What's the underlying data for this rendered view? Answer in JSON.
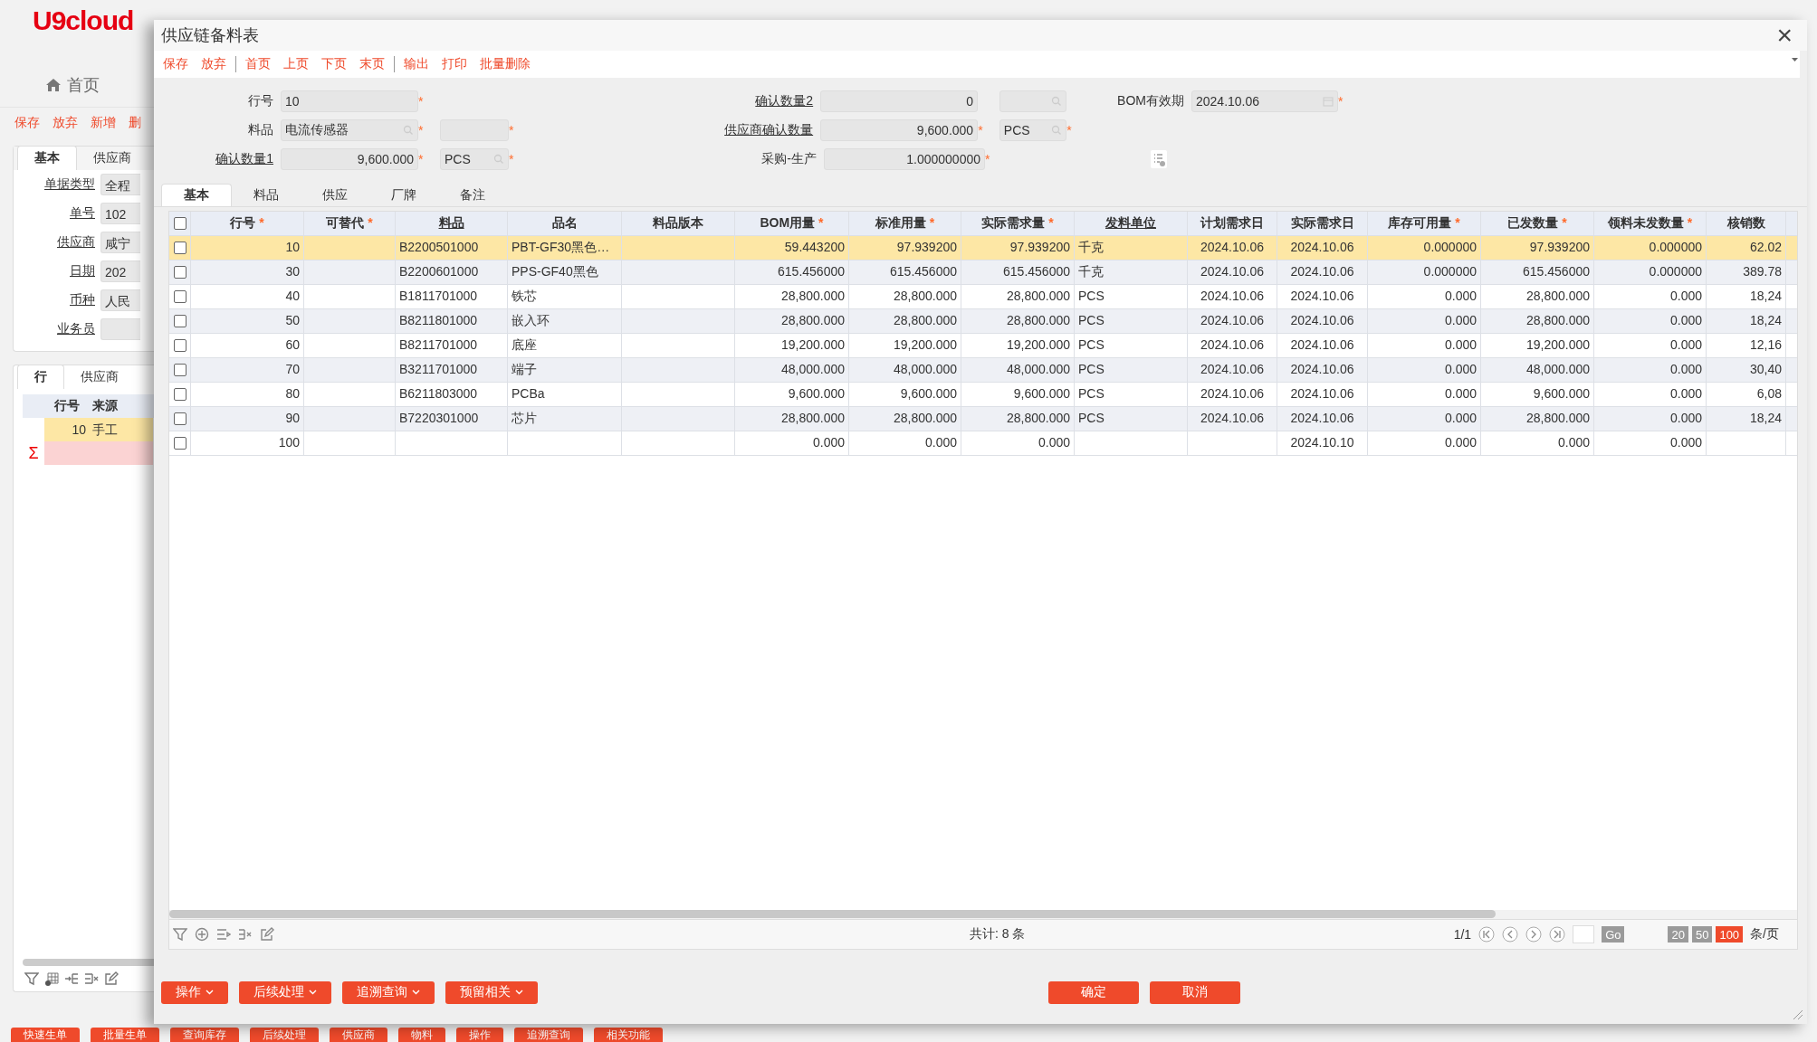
{
  "background": {
    "logo": "U9cloud",
    "home": "首页",
    "toolbar": [
      "保存",
      "放弃",
      "新增",
      "删"
    ],
    "tabs": [
      {
        "label": "基本",
        "selected": true
      },
      {
        "label": "供应商",
        "selected": false
      }
    ],
    "fields": [
      {
        "label": "单据类型",
        "value": "全程"
      },
      {
        "label": "单号",
        "value": "102"
      },
      {
        "label": "供应商",
        "value": "咸宁"
      },
      {
        "label": "日期",
        "value": "202"
      },
      {
        "label": "币种",
        "value": "人民"
      },
      {
        "label": "业务员"
      }
    ],
    "line_tabs": [
      {
        "label": "行",
        "selected": true
      },
      {
        "label": "供应商",
        "selected": false
      }
    ],
    "table": {
      "columns": [
        "行号",
        "来源"
      ],
      "rows": [
        [
          "10",
          "手工"
        ]
      ],
      "sum_mark": "Σ"
    },
    "bottom_buttons": [
      "快速生单",
      "批量生单",
      "查询库存",
      "后续处理",
      "供应商",
      "物料",
      "操作",
      "追溯查询",
      "相关功能"
    ]
  },
  "dialog": {
    "title": "供应链备料表",
    "close": "×",
    "toolbar": [
      [
        "保存",
        "放弃"
      ],
      [
        "首页",
        "上页",
        "下页",
        "末页"
      ],
      [
        "输出",
        "打印",
        "批量删除"
      ]
    ],
    "form": [
      [
        {
          "label": "行号",
          "link": false,
          "value": "10",
          "kind": "text",
          "mark": "*"
        },
        {
          "label": "确认数量2",
          "link": true,
          "value": "0",
          "kind": "number",
          "unit": {
            "lookup": true
          }
        },
        {
          "label": "BOM有效期",
          "link": false,
          "value": "2024.10.06",
          "kind": "date",
          "mark": "*"
        }
      ],
      [
        {
          "label": "料品",
          "link": false,
          "value": "电流传感器",
          "kind": "lookup",
          "mark": "*",
          "unit": {
            "lookup": false,
            "mark": "*"
          }
        },
        {
          "label": "供应商确认数量",
          "link": true,
          "value": "9,600.000",
          "kind": "number",
          "mark": "*",
          "unit": {
            "value": "PCS",
            "lookup": true,
            "mark": "*"
          }
        }
      ],
      [
        {
          "label": "确认数量1",
          "link": true,
          "value": "9,600.000",
          "kind": "number",
          "mark": "*",
          "unit": {
            "value": "PCS",
            "lookup": true,
            "mark": "*"
          }
        },
        {
          "label": "采购-生产",
          "link": false,
          "value": "1.000000000",
          "kind": "number",
          "mark": "*"
        }
      ]
    ],
    "tabs": [
      {
        "label": "基本",
        "selected": true
      },
      {
        "label": "料品",
        "selected": false
      },
      {
        "label": "供应",
        "selected": false
      },
      {
        "label": "厂牌",
        "selected": false
      },
      {
        "label": "备注",
        "selected": false
      }
    ],
    "table": {
      "select_all_checked": false,
      "columns": [
        {
          "label": "行号",
          "mark": "*",
          "link": false
        },
        {
          "label": "可替代",
          "mark": "*",
          "link": false
        },
        {
          "label": "料品",
          "link": true
        },
        {
          "label": "品名",
          "link": false
        },
        {
          "label": "料品版本",
          "link": false
        },
        {
          "label": "BOM用量",
          "mark": "*",
          "link": false
        },
        {
          "label": "标准用量",
          "mark": "*",
          "link": false
        },
        {
          "label": "实际需求量",
          "mark": "*",
          "link": false
        },
        {
          "label": "发料单位",
          "link": true
        },
        {
          "label": "计划需求日",
          "link": false
        },
        {
          "label": "实际需求日",
          "link": false
        },
        {
          "label": "库存可用量",
          "mark": "*",
          "link": false
        },
        {
          "label": "已发数量",
          "mark": "*",
          "link": false
        },
        {
          "label": "领料未发数量",
          "mark": "*",
          "link": false
        },
        {
          "label": "核销数",
          "link": false
        }
      ],
      "rows": [
        {
          "selected": true,
          "checked": false,
          "cells": [
            "10",
            "",
            "B2200501000",
            "PBT-GF30黑色…",
            "",
            "59.443200",
            "97.939200",
            "97.939200",
            "千克",
            "2024.10.06",
            "2024.10.06",
            "0.000000",
            "97.939200",
            "0.000000",
            "62.02"
          ]
        },
        {
          "selected": false,
          "checked": false,
          "cells": [
            "30",
            "",
            "B2200601000",
            "PPS-GF40黑色",
            "",
            "615.456000",
            "615.456000",
            "615.456000",
            "千克",
            "2024.10.06",
            "2024.10.06",
            "0.000000",
            "615.456000",
            "0.000000",
            "389.78"
          ]
        },
        {
          "selected": false,
          "checked": false,
          "cells": [
            "40",
            "",
            "B1811701000",
            "铁芯",
            "",
            "28,800.000",
            "28,800.000",
            "28,800.000",
            "PCS",
            "2024.10.06",
            "2024.10.06",
            "0.000",
            "28,800.000",
            "0.000",
            "18,24"
          ]
        },
        {
          "selected": false,
          "checked": false,
          "cells": [
            "50",
            "",
            "B8211801000",
            "嵌入环",
            "",
            "28,800.000",
            "28,800.000",
            "28,800.000",
            "PCS",
            "2024.10.06",
            "2024.10.06",
            "0.000",
            "28,800.000",
            "0.000",
            "18,24"
          ]
        },
        {
          "selected": false,
          "checked": false,
          "cells": [
            "60",
            "",
            "B8211701000",
            "底座",
            "",
            "19,200.000",
            "19,200.000",
            "19,200.000",
            "PCS",
            "2024.10.06",
            "2024.10.06",
            "0.000",
            "19,200.000",
            "0.000",
            "12,16"
          ]
        },
        {
          "selected": false,
          "checked": false,
          "cells": [
            "70",
            "",
            "B3211701000",
            "端子",
            "",
            "48,000.000",
            "48,000.000",
            "48,000.000",
            "PCS",
            "2024.10.06",
            "2024.10.06",
            "0.000",
            "48,000.000",
            "0.000",
            "30,40"
          ]
        },
        {
          "selected": false,
          "checked": false,
          "cells": [
            "80",
            "",
            "B6211803000",
            "PCBa",
            "",
            "9,600.000",
            "9,600.000",
            "9,600.000",
            "PCS",
            "2024.10.06",
            "2024.10.06",
            "0.000",
            "9,600.000",
            "0.000",
            "6,08"
          ]
        },
        {
          "selected": false,
          "checked": false,
          "cells": [
            "90",
            "",
            "B7220301000",
            "芯片",
            "",
            "28,800.000",
            "28,800.000",
            "28,800.000",
            "PCS",
            "2024.10.06",
            "2024.10.06",
            "0.000",
            "28,800.000",
            "0.000",
            "18,24"
          ]
        },
        {
          "selected": false,
          "checked": false,
          "cells": [
            "100",
            "",
            "",
            "",
            "",
            "0.000",
            "0.000",
            "0.000",
            "",
            "",
            "2024.10.10",
            "0.000",
            "0.000",
            "0.000",
            ""
          ]
        }
      ]
    },
    "footer": {
      "total": "共计: 8 条",
      "page": "1/1",
      "go": "Go",
      "sizes": [
        {
          "label": "20",
          "selected": false
        },
        {
          "label": "50",
          "selected": false
        },
        {
          "label": "100",
          "selected": true
        }
      ],
      "per_page": "条/页"
    },
    "actions": [
      "操作",
      "后续处理",
      "追溯查询",
      "预留相关"
    ],
    "confirm": [
      "确定",
      "取消"
    ]
  }
}
